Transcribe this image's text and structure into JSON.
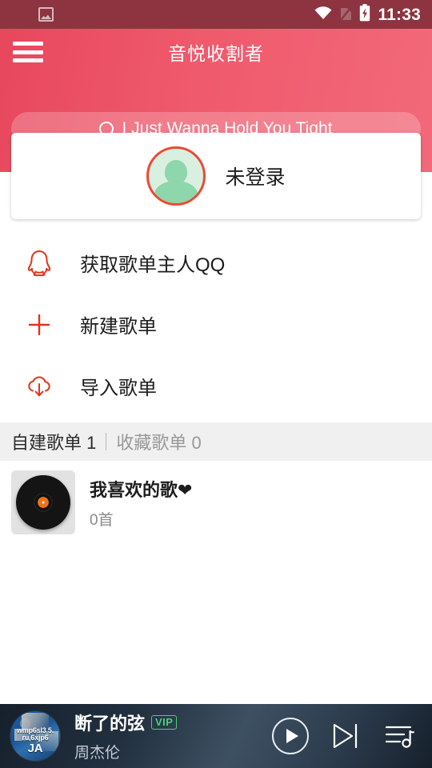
{
  "status_bar": {
    "time": "11:33",
    "icons": [
      "screenshot-image-icon",
      "wifi-icon",
      "sim-card-off-icon",
      "battery-charging-icon"
    ]
  },
  "header": {
    "menu_icon": "hamburger-menu-icon",
    "title": "音悦收割者",
    "accent_color": "#ef5a6c",
    "search": {
      "icon": "search-icon",
      "value": "I Just Wanna Hold You Tight",
      "placeholder": "I Just Wanna Hold You Tight"
    }
  },
  "profile": {
    "avatar_icon": "default-user-avatar",
    "name": "未登录"
  },
  "menu": {
    "items": [
      {
        "icon": "qq-penguin-icon",
        "label": "获取歌单主人QQ"
      },
      {
        "icon": "plus-icon",
        "label": "新建歌单"
      },
      {
        "icon": "cloud-download-icon",
        "label": "导入歌单"
      }
    ]
  },
  "section": {
    "active_label": "自建歌单 1",
    "divider": "|",
    "inactive_label": "收藏歌单 0"
  },
  "playlists": [
    {
      "thumb": "vinyl-record-icon",
      "title": "我喜欢的歌❤",
      "count": "0首"
    }
  ],
  "player": {
    "album_art": "album-cover-art",
    "album_art_text_line1": "wmp6sl3",
    "album_art_text_line2": "5. ru,6xjp6",
    "album_art_text_big": "JA",
    "track_title": "断了的弦",
    "vip_badge": "VIP",
    "vip_color": "#4ad17a",
    "artist": "周杰伦",
    "controls": [
      {
        "icon": "play-button-icon",
        "name": "play"
      },
      {
        "icon": "next-track-icon",
        "name": "next"
      },
      {
        "icon": "playlist-queue-icon",
        "name": "queue"
      }
    ]
  }
}
